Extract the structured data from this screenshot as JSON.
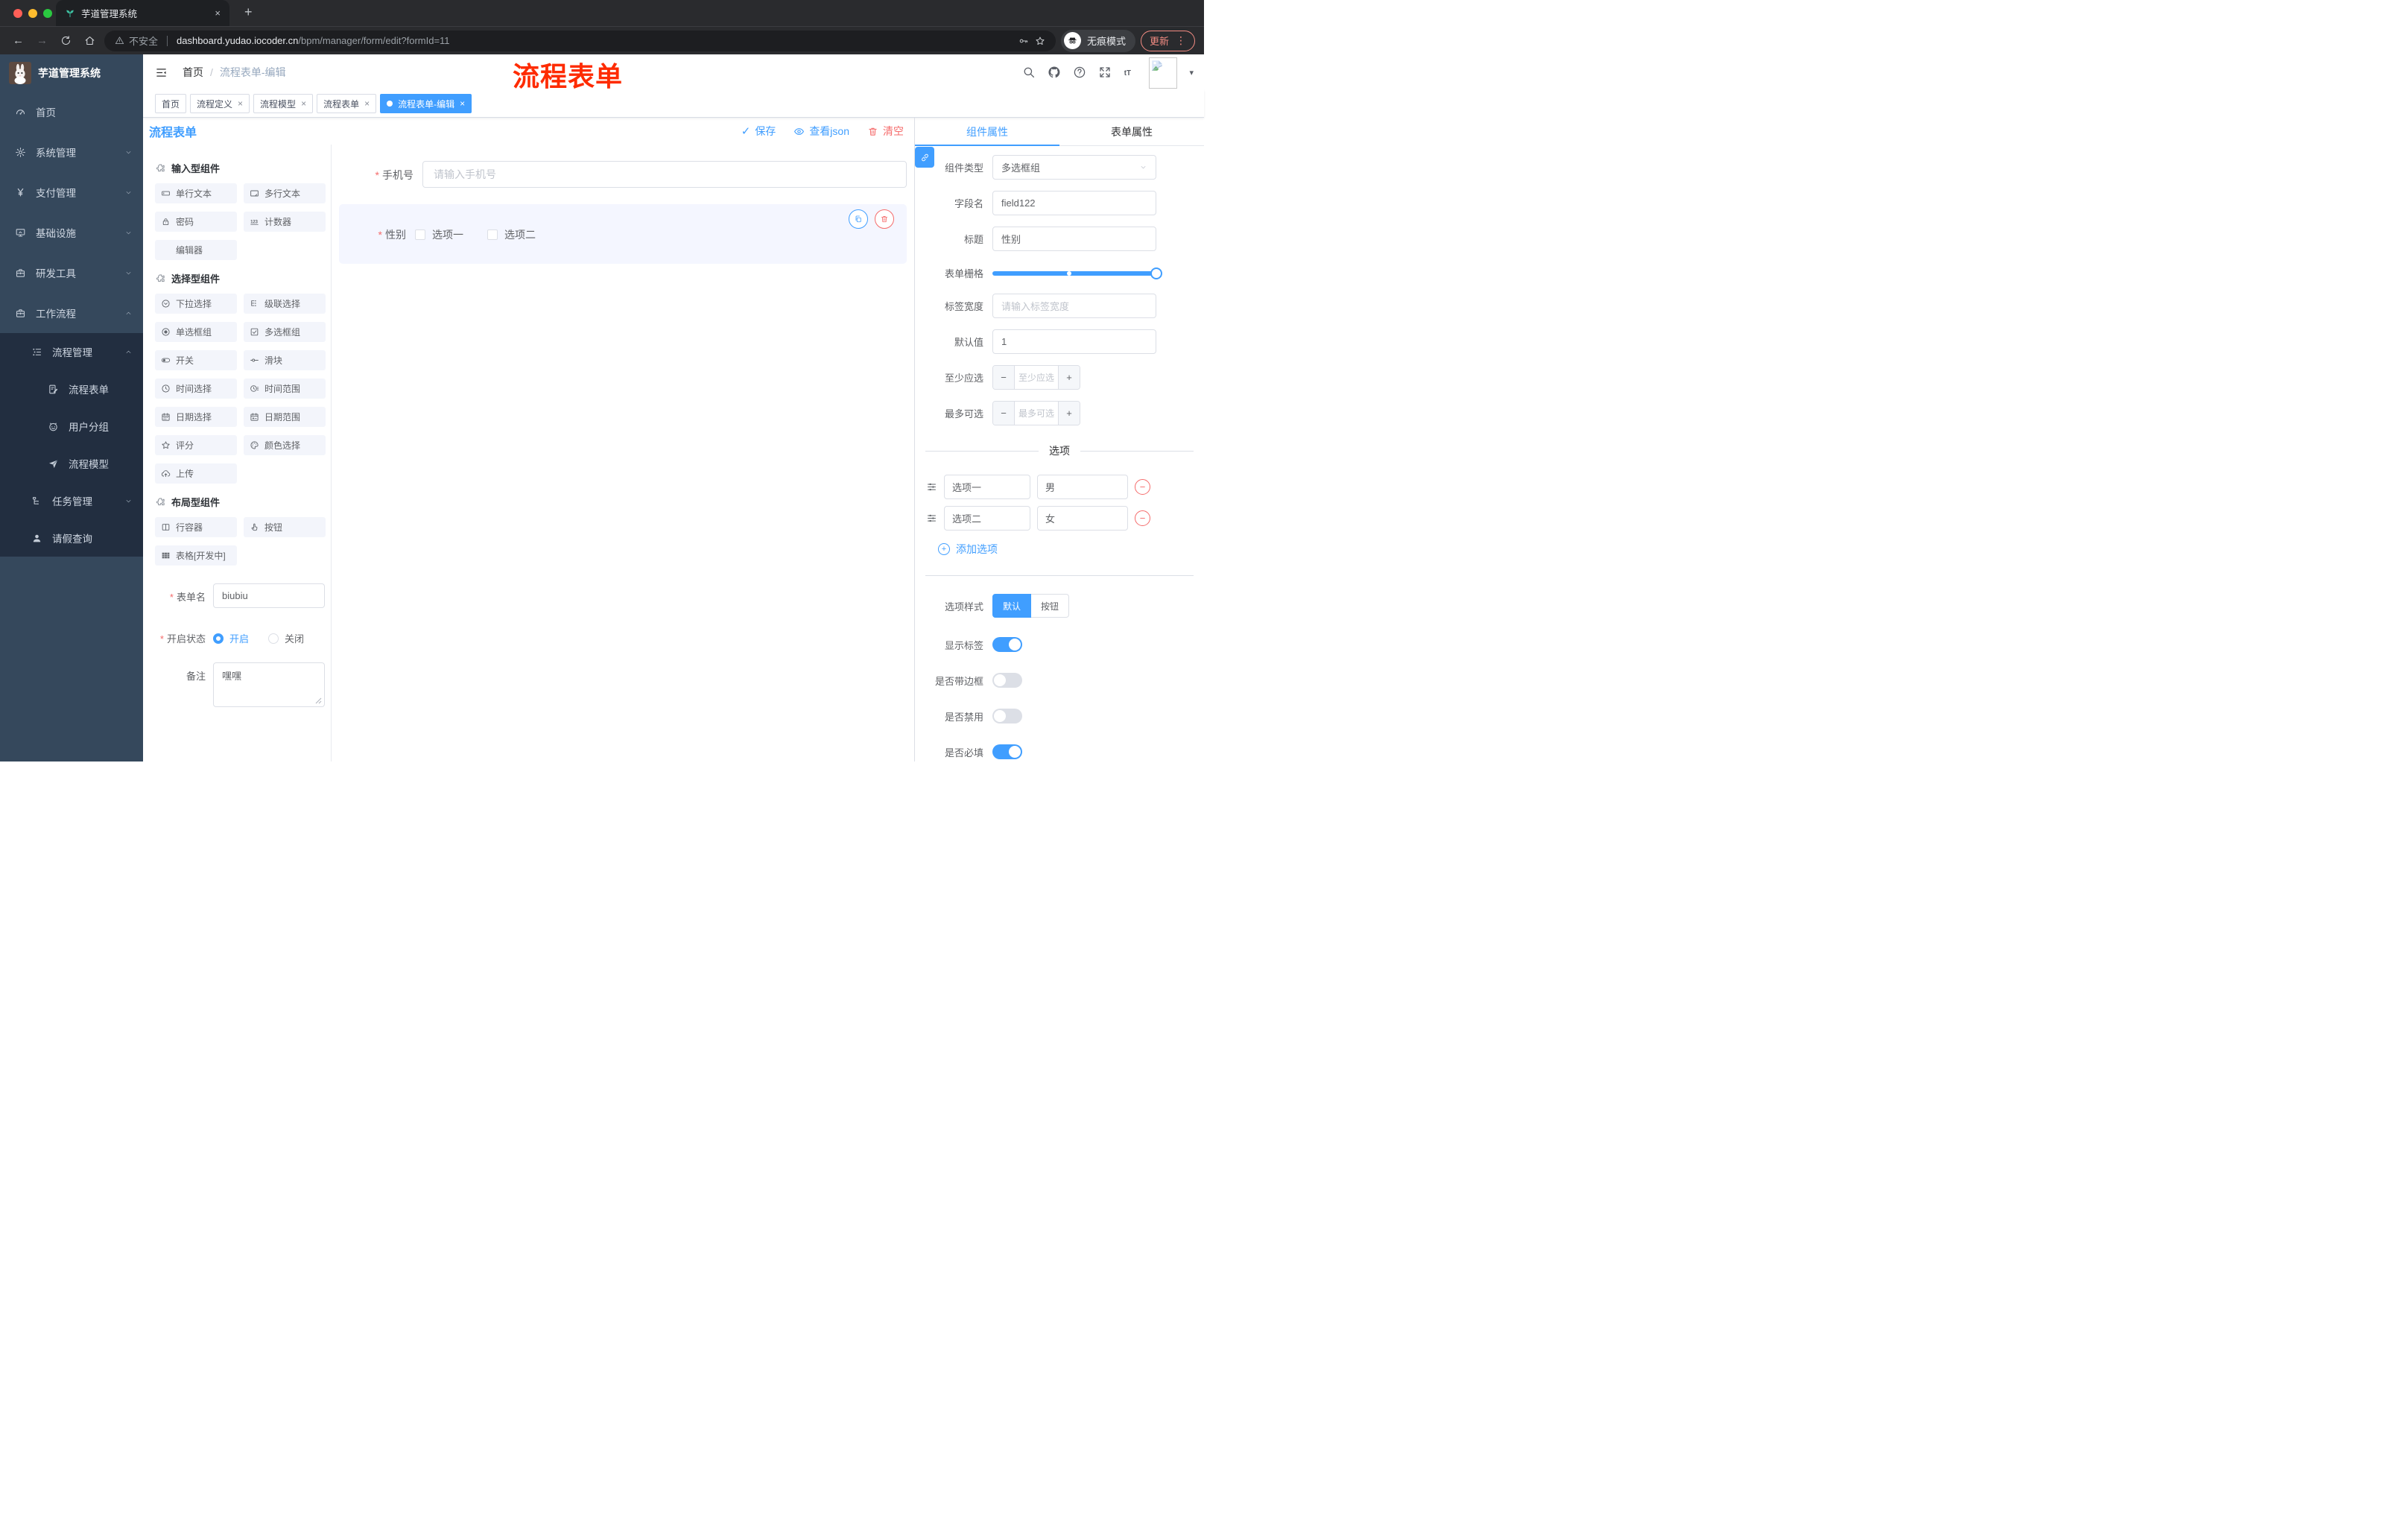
{
  "colors": {
    "primary": "#409eff",
    "danger": "#f56c6c",
    "annotation_red": "#fe2b00",
    "sidebar_bg": "#35485c",
    "submenu_bg": "#222e40",
    "tab_active_bg": "#409eff"
  },
  "browser": {
    "tab_title": "芋道管理系统",
    "favicon": "seedling-icon",
    "security_label": "不安全",
    "url_host": "dashboard.yudao.iocoder.cn",
    "url_path": "/bpm/manager/form/edit?formId=11",
    "incognito_label": "无痕模式",
    "update_label": "更新"
  },
  "sidebar": {
    "logo_title": "芋道管理系统",
    "menu": [
      {
        "id": "home",
        "icon": "dashboard",
        "label": "首页",
        "chevron": ""
      },
      {
        "id": "system",
        "icon": "gear",
        "label": "系统管理",
        "chevron": "down"
      },
      {
        "id": "payment",
        "icon": "yen",
        "label": "支付管理",
        "chevron": "down"
      },
      {
        "id": "infra",
        "icon": "monitor",
        "label": "基础设施",
        "chevron": "down"
      },
      {
        "id": "devtools",
        "icon": "briefcase",
        "label": "研发工具",
        "chevron": "down"
      },
      {
        "id": "workflow",
        "icon": "briefcase",
        "label": "工作流程",
        "chevron": "up"
      }
    ],
    "process_group": {
      "label": "流程管理",
      "icon": "list-tree",
      "chevron": "up"
    },
    "process_items": [
      {
        "id": "process-form",
        "icon": "doc-edit",
        "label": "流程表单"
      },
      {
        "id": "user-group",
        "icon": "robot",
        "label": "用户分组"
      },
      {
        "id": "process-model",
        "icon": "plane",
        "label": "流程模型"
      }
    ],
    "task_item": {
      "label": "任务管理",
      "icon": "org-tree",
      "chevron": "down"
    },
    "leave_item": {
      "label": "请假查询",
      "icon": "person"
    }
  },
  "header": {
    "breadcrumb": {
      "home": "首页",
      "separator": "/",
      "current": "流程表单-编辑"
    },
    "annotation": "流程表单"
  },
  "tags": [
    {
      "id": "home",
      "label": "首页",
      "closable": false,
      "active": false
    },
    {
      "id": "process-def",
      "label": "流程定义",
      "closable": true,
      "active": false
    },
    {
      "id": "process-model",
      "label": "流程模型",
      "closable": true,
      "active": false
    },
    {
      "id": "process-form",
      "label": "流程表单",
      "closable": true,
      "active": false
    },
    {
      "id": "process-form-edit",
      "label": "流程表单-编辑",
      "closable": true,
      "active": true
    }
  ],
  "toolbar": {
    "title": "流程表单",
    "save_label": "保存",
    "view_json_label": "查看json",
    "clear_label": "清空"
  },
  "components": {
    "sections": [
      {
        "title": "输入型组件",
        "items": [
          {
            "id": "single-line-text",
            "icon": "input",
            "label": "单行文本"
          },
          {
            "id": "multi-line-text",
            "icon": "textarea",
            "label": "多行文本"
          },
          {
            "id": "password",
            "icon": "lock",
            "label": "密码"
          },
          {
            "id": "counter",
            "icon": "counter",
            "label": "计数器"
          },
          {
            "id": "editor",
            "icon": "none",
            "label": "编辑器"
          }
        ]
      },
      {
        "title": "选择型组件",
        "items": [
          {
            "id": "select",
            "icon": "select",
            "label": "下拉选择"
          },
          {
            "id": "cascader",
            "icon": "cascader",
            "label": "级联选择"
          },
          {
            "id": "radio-group",
            "icon": "radio",
            "label": "单选框组"
          },
          {
            "id": "checkbox-group",
            "icon": "checkbox",
            "label": "多选框组"
          },
          {
            "id": "switch",
            "icon": "switch",
            "label": "开关"
          },
          {
            "id": "slider",
            "icon": "slider",
            "label": "滑块"
          },
          {
            "id": "time-picker",
            "icon": "clock",
            "label": "时间选择"
          },
          {
            "id": "time-range",
            "icon": "time-range",
            "label": "时间范围"
          },
          {
            "id": "date-picker",
            "icon": "calendar",
            "label": "日期选择"
          },
          {
            "id": "date-range",
            "icon": "date-range",
            "label": "日期范围"
          },
          {
            "id": "rate",
            "icon": "star",
            "label": "评分"
          },
          {
            "id": "color-picker",
            "icon": "palette",
            "label": "颜色选择"
          },
          {
            "id": "upload",
            "icon": "upload",
            "label": "上传"
          }
        ]
      },
      {
        "title": "布局型组件",
        "items": [
          {
            "id": "row-container",
            "icon": "row-container",
            "label": "行容器"
          },
          {
            "id": "button",
            "icon": "hand",
            "label": "按钮"
          },
          {
            "id": "table",
            "icon": "table",
            "label": "表格[开发中]"
          }
        ]
      }
    ],
    "form": {
      "name_label": "表单名",
      "name_value": "biubiu",
      "status_label": "开启状态",
      "status_on": "开启",
      "status_off": "关闭",
      "remark_label": "备注",
      "remark_value": "嘿嘿"
    }
  },
  "canvas": {
    "phone": {
      "label": "手机号",
      "placeholder": "请输入手机号"
    },
    "gender": {
      "label": "性别",
      "option1": "选项一",
      "option2": "选项二"
    }
  },
  "props": {
    "tab_component": "组件属性",
    "tab_form": "表单属性",
    "component_type_label": "组件类型",
    "component_type_value": "多选框组",
    "field_name_label": "字段名",
    "field_name_value": "field122",
    "title_label": "标题",
    "title_value": "性别",
    "grid_label": "表单栅格",
    "label_width_label": "标签宽度",
    "label_width_placeholder": "请输入标签宽度",
    "default_label": "默认值",
    "default_value": "1",
    "min_label": "至少应选",
    "min_placeholder": "至少应选",
    "max_label": "最多可选",
    "max_placeholder": "最多可选",
    "options_divider": "选项",
    "options": [
      {
        "name": "选项一",
        "value": "男"
      },
      {
        "name": "选项二",
        "value": "女"
      }
    ],
    "add_option_label": "添加选项",
    "option_style_label": "选项样式",
    "option_style_default": "默认",
    "option_style_button": "按钮",
    "switch_show_label": "显示标签",
    "switch_border_label": "是否带边框",
    "switch_disabled_label": "是否禁用",
    "switch_required_label": "是否必填"
  }
}
